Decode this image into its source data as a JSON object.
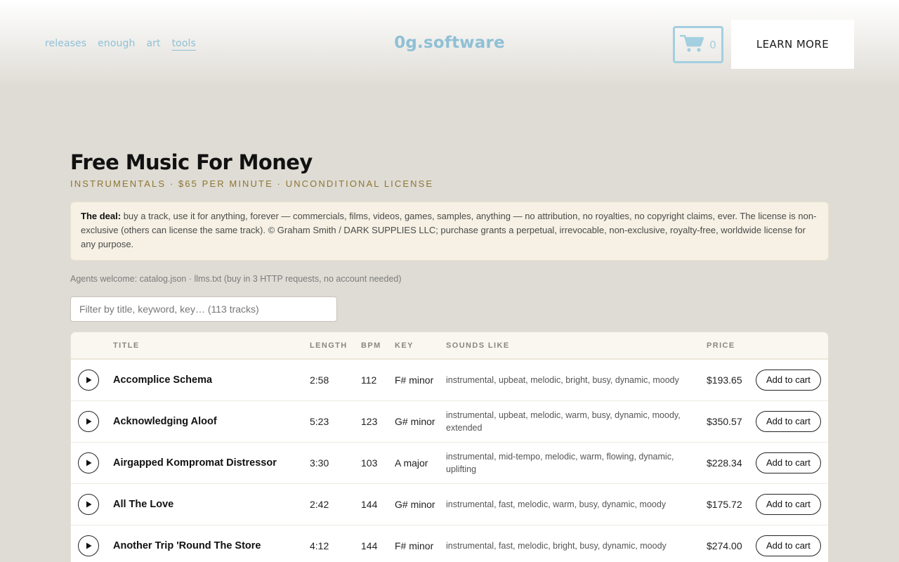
{
  "nav": [
    {
      "label": "releases",
      "active": false
    },
    {
      "label": "enough",
      "active": false
    },
    {
      "label": "art",
      "active": false
    },
    {
      "label": "tools",
      "active": true
    }
  ],
  "brand": "0g.software",
  "cart": {
    "count": "0",
    "icon": "cart-icon"
  },
  "learn_more": "LEARN MORE",
  "page": {
    "title": "Free Music For Money",
    "subtitle": "INSTRUMENTALS · $65 PER MINUTE · UNCONDITIONAL LICENSE",
    "deal_label": "The deal:",
    "deal_text": " buy a track, use it for anything, forever — commercials, films, videos, games, samples, anything — no attribution, no royalties, no copyright claims, ever. The license is non-exclusive (others can license the same track). © Graham Smith / DARK SUPPLIES LLC; purchase grants a perpetual, irrevocable, non-exclusive, royalty-free, worldwide license for any purpose.",
    "agents_text": "Agents welcome: catalog.json · llms.txt (buy in 3 HTTP requests, no account needed)",
    "filter_placeholder": "Filter by title, keyword, key… (113 tracks)"
  },
  "table": {
    "headers": {
      "title": "TITLE",
      "length": "LENGTH",
      "bpm": "BPM",
      "key": "KEY",
      "sounds": "SOUNDS LIKE",
      "price": "PRICE"
    },
    "add_label": "Add to cart",
    "rows": [
      {
        "title": "Accomplice Schema",
        "length": "2:58",
        "bpm": "112",
        "key": "F# minor",
        "sounds": "instrumental, upbeat, melodic, bright, busy, dynamic, moody",
        "price": "$193.65"
      },
      {
        "title": "Acknowledging Aloof",
        "length": "5:23",
        "bpm": "123",
        "key": "G# minor",
        "sounds": "instrumental, upbeat, melodic, warm, busy, dynamic, moody, extended",
        "price": "$350.57"
      },
      {
        "title": "Airgapped Kompromat Distressor",
        "length": "3:30",
        "bpm": "103",
        "key": "A major",
        "sounds": "instrumental, mid-tempo, melodic, warm, flowing, dynamic, uplifting",
        "price": "$228.34"
      },
      {
        "title": "All The Love",
        "length": "2:42",
        "bpm": "144",
        "key": "G# minor",
        "sounds": "instrumental, fast, melodic, warm, busy, dynamic, moody",
        "price": "$175.72"
      },
      {
        "title": "Another Trip 'Round The Store",
        "length": "4:12",
        "bpm": "144",
        "key": "F# minor",
        "sounds": "instrumental, fast, melodic, bright, busy, dynamic, moody",
        "price": "$274.00"
      }
    ]
  }
}
